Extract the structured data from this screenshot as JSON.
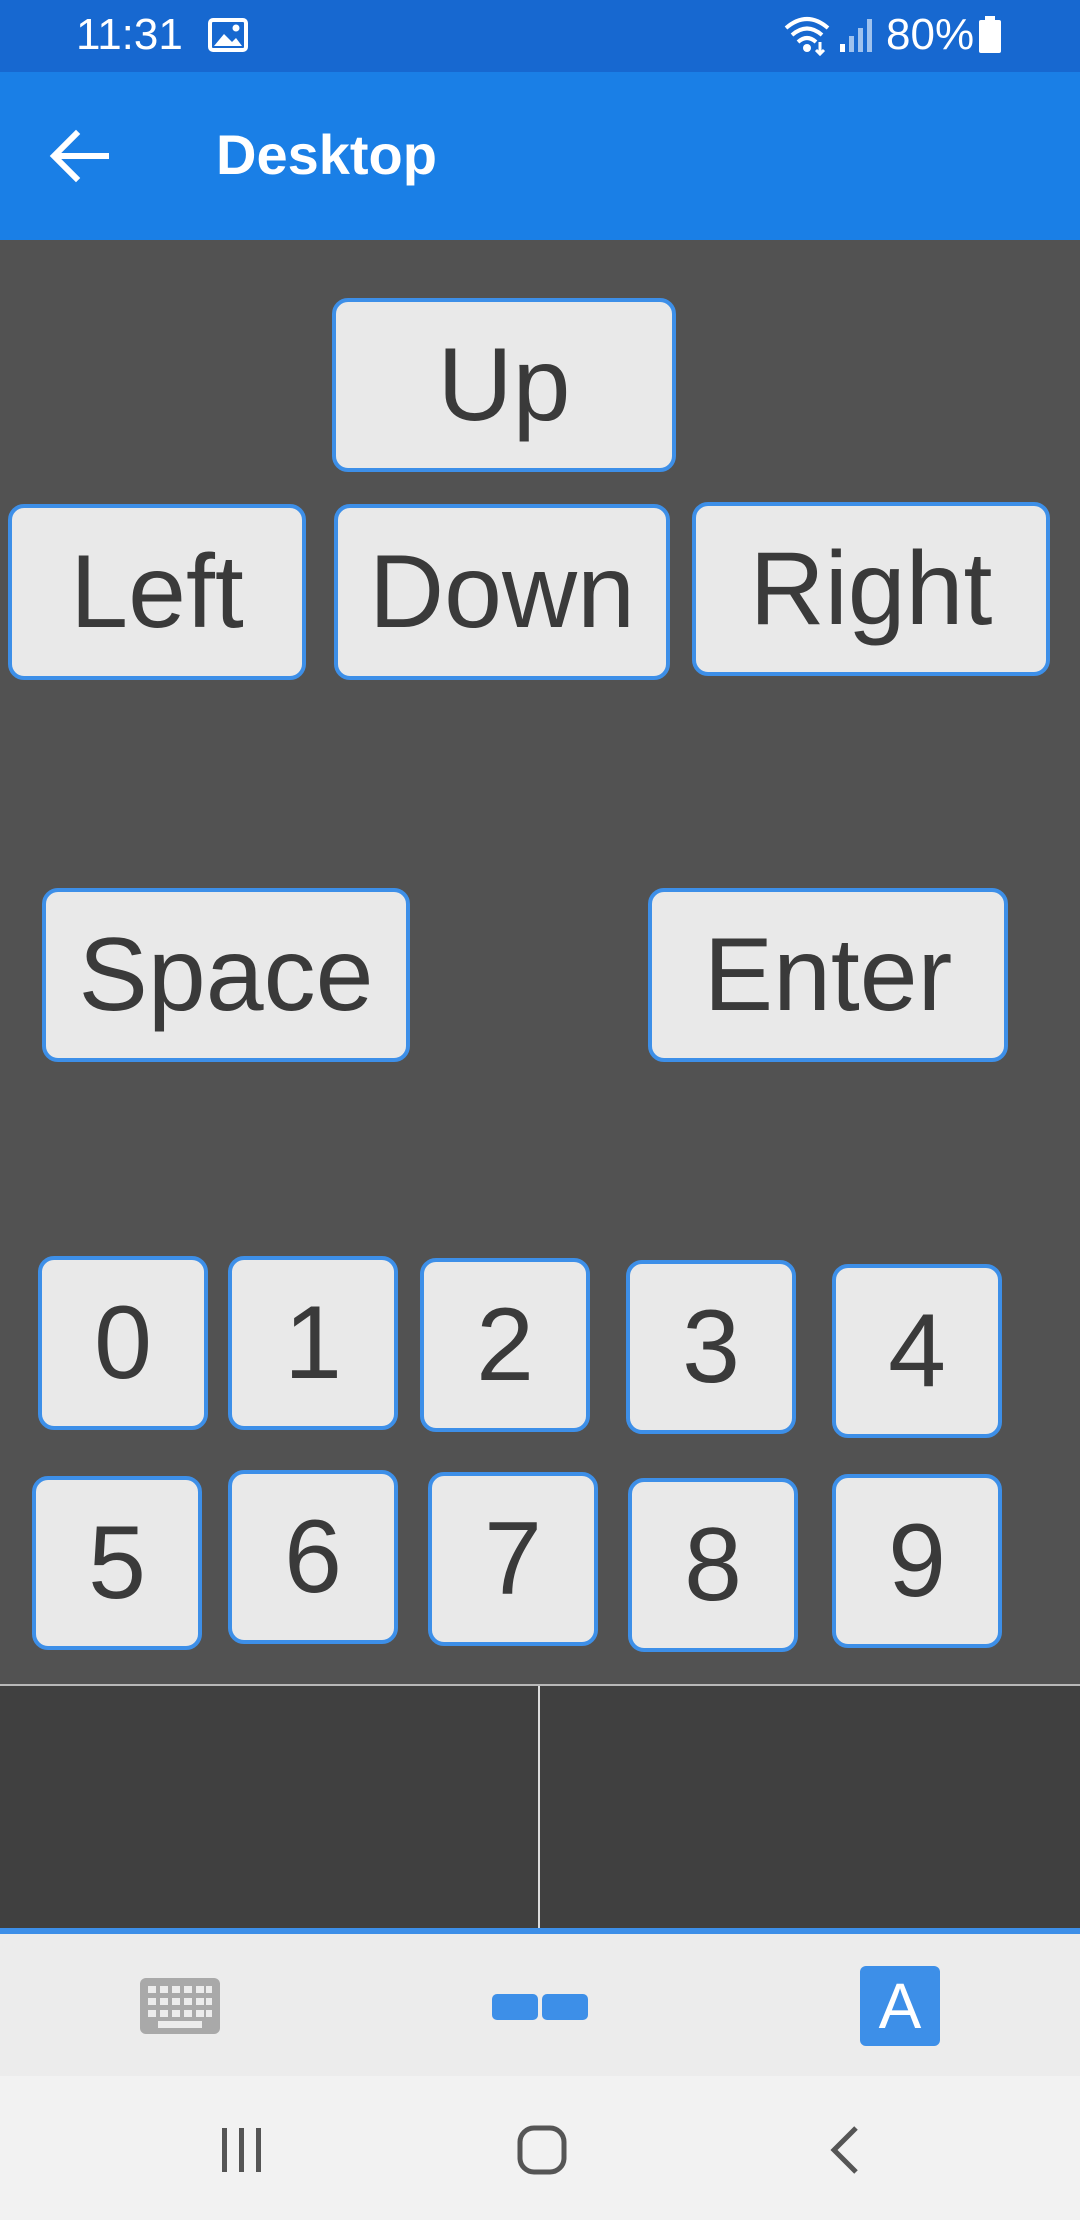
{
  "status_bar": {
    "time": "11:31",
    "battery": "80%",
    "icons": [
      "image-icon",
      "wifi-icon",
      "signal-icon",
      "battery-icon"
    ]
  },
  "app_bar": {
    "title": "Desktop",
    "back_icon": "arrow-left-icon"
  },
  "arrow_keys": {
    "up": "Up",
    "left": "Left",
    "down": "Down",
    "right": "Right"
  },
  "action_keys": {
    "space": "Space",
    "enter": "Enter"
  },
  "number_keys": {
    "row1": [
      "0",
      "1",
      "2",
      "3",
      "4"
    ],
    "row2": [
      "5",
      "6",
      "7",
      "8",
      "9"
    ]
  },
  "bottom_tabs": {
    "keyboard_icon": "keyboard-icon",
    "touchpad_icon": "touchpad-icon",
    "text_label": "A"
  },
  "colors": {
    "status_bar": "#1768d0",
    "app_bar": "#1a7fe6",
    "accent": "#3d8fe8",
    "background": "#525252",
    "key_face": "#e9e9e9"
  }
}
